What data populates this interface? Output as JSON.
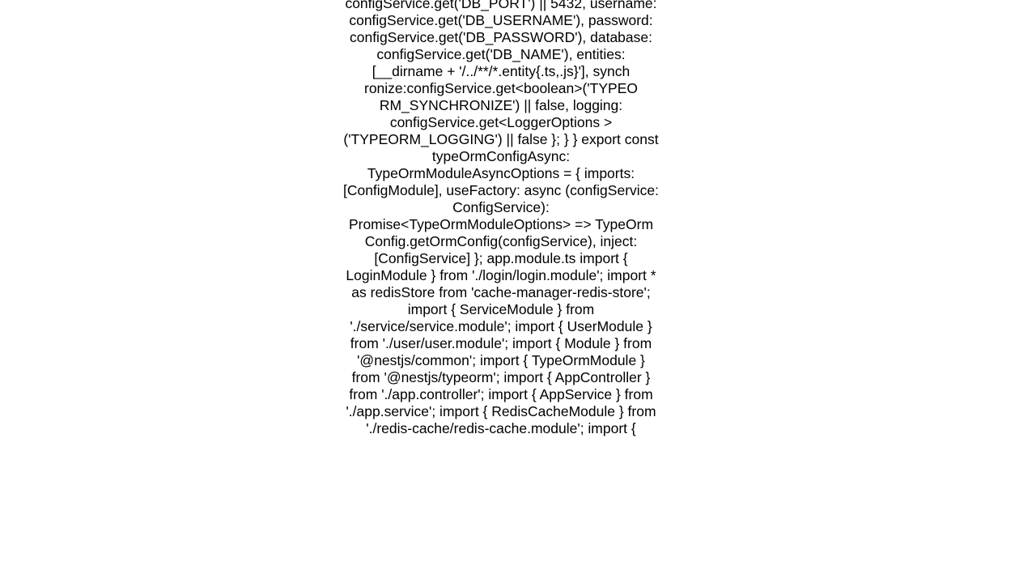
{
  "document": {
    "body": "configService.get('DB_PORT') || 5432,       username: configService.get('DB_USERNAME'),       password: configService.get('DB_PASSWORD'),       database: configService.get('DB_NAME'),       entities: [__dirname + '/../**/*.entity{.ts,.js}'],       synch ronize:configService.get<boolean>('TYPEO RM_SYNCHRONIZE') || false,       logging: configService.get<LoggerOptions >('TYPEORM_LOGGING') || false     };   } }  export const typeOrmConfigAsync: TypeOrmModuleAsyncOptions = {   imports: [ConfigModule],   useFactory: async (configService: ConfigService): Promise<TypeOrmModuleOptions> => TypeOrm Config.getOrmConfig(configService),   inject: [ConfigService] };  app.module.ts import { LoginModule } from './login/login.module'; import * as redisStore from 'cache-manager-redis-store'; import { ServiceModule } from './service/service.module'; import { UserModule } from './user/user.module'; import { Module } from '@nestjs/common'; import { TypeOrmModule } from '@nestjs/typeorm'; import { AppController } from './app.controller'; import { AppService } from './app.service'; import { RedisCacheModule } from './redis-cache/redis-cache.module'; import {"
  }
}
